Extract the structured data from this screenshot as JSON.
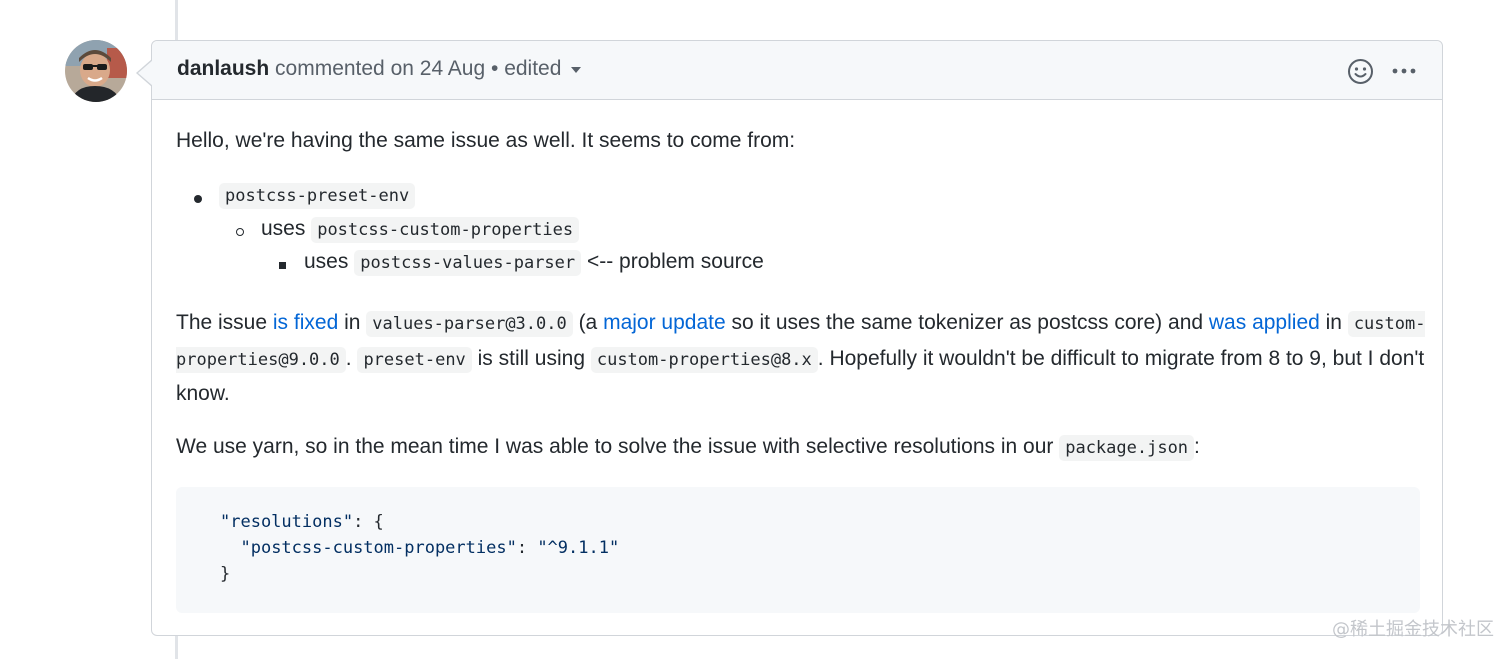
{
  "comment": {
    "author": "danlaush",
    "action": " commented on 24 Aug",
    "separator": " • ",
    "edited_label": "edited",
    "body": {
      "intro": "Hello, we're having the same issue as well. It seems to come from:",
      "list": {
        "level1_code": "postcss-preset-env",
        "level2_prefix": "uses ",
        "level2_code": "postcss-custom-properties",
        "level3_prefix": "uses ",
        "level3_code": "postcss-values-parser",
        "level3_suffix": " <-- problem source"
      },
      "para2": {
        "t1": "The issue ",
        "link_fixed": "is fixed",
        "t2": " in ",
        "code1": "values-parser@3.0.0",
        "t3": " (a ",
        "link_major": "major update",
        "t4": " so it uses the same tokenizer as postcss core) and ",
        "link_applied": "was applied",
        "t5": " in ",
        "code2": "custom-properties@9.0.0",
        "t6": ". ",
        "code3": "preset-env",
        "t7": " is still using ",
        "code4": "custom-properties@8.x",
        "t8": ". Hopefully it wouldn't be difficult to migrate from 8 to 9, but I don't know."
      },
      "para3": {
        "t1": "We use yarn, so in the mean time I was able to solve the issue with selective resolutions in our ",
        "code1": "package.json",
        "t2": ":"
      },
      "code_block": {
        "line1_key": "\"resolutions\"",
        "line1_rest": ": {",
        "line2_key": "\"postcss-custom-properties\"",
        "line2_sep": ": ",
        "line2_val": "\"^9.1.1\"",
        "line3": "}"
      }
    }
  },
  "icons": {
    "avatar": "user-avatar",
    "emoji": "smiley-icon",
    "menu": "kebab-horizontal-icon"
  },
  "colors": {
    "link": "#0366d6",
    "header_bg": "#f6f8fa",
    "border": "#d1d5da"
  },
  "watermark": "@稀土掘金技术社区"
}
